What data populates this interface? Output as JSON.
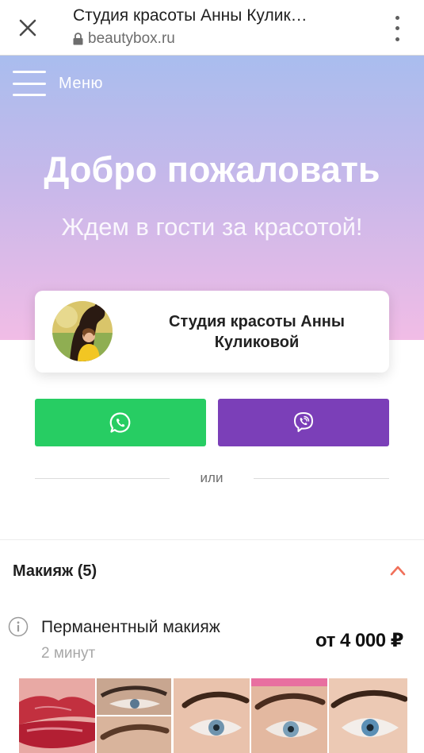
{
  "browser": {
    "page_title": "Студия красоты Анны Кулик…",
    "url": "beautybox.ru",
    "close_icon": "close-icon",
    "lock_icon": "lock-icon",
    "more_icon": "more-vertical-icon"
  },
  "hero": {
    "menu_label": "Меню",
    "menu_icon": "hamburger-icon",
    "title": "Добро пожаловать",
    "subtitle": "Ждем в гости за красотой!",
    "gradient_colors": [
      "#a9bdee",
      "#c7b8ea",
      "#f1bce6"
    ]
  },
  "studio": {
    "name_line1": "Студия красоты Анны",
    "name_line2": "Куликовой"
  },
  "contacts": {
    "whatsapp_color": "#27cd63",
    "viber_color": "#7b3fb8",
    "whatsapp_icon": "whatsapp-icon",
    "viber_icon": "viber-icon",
    "or_label": "или"
  },
  "category": {
    "title": "Макияж (5)",
    "toggle_icon": "chevron-up-icon",
    "accent_color": "#f0705a"
  },
  "service": {
    "info_icon": "info-icon",
    "name": "Перманентный макияж",
    "duration": "2 минут",
    "price": "от 4 000 ₽"
  }
}
